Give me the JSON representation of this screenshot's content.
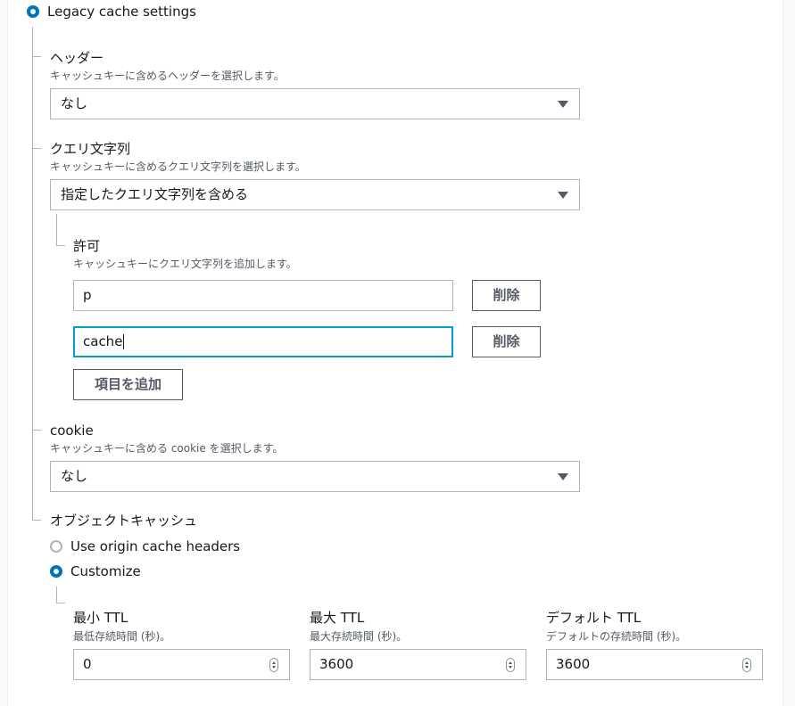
{
  "legacy": {
    "label": "Legacy cache settings"
  },
  "headers": {
    "title": "ヘッダー",
    "description": "キャッシュキーに含めるヘッダーを選択します。",
    "value": "なし"
  },
  "query": {
    "title": "クエリ文字列",
    "description": "キャッシュキーに含めるクエリ文字列を選択します。",
    "value": "指定したクエリ文字列を含める",
    "allow": {
      "title": "許可",
      "description": "キャッシュキーにクエリ文字列を追加します。",
      "items": [
        {
          "value": "p",
          "remove_label": "削除"
        },
        {
          "value": "cache",
          "remove_label": "削除"
        }
      ],
      "add_label": "項目を追加"
    }
  },
  "cookie": {
    "title": "cookie",
    "description": "キャッシュキーに含める cookie を選択します。",
    "value": "なし"
  },
  "object_cache": {
    "title": "オブジェクトキャッシュ",
    "options": [
      {
        "label": "Use origin cache headers",
        "selected": false
      },
      {
        "label": "Customize",
        "selected": true
      }
    ],
    "ttl": {
      "min": {
        "title": "最小 TTL",
        "description": "最低存続時間 (秒)。",
        "value": "0"
      },
      "max": {
        "title": "最大 TTL",
        "description": "最大存続時間 (秒)。",
        "value": "3600"
      },
      "default": {
        "title": "デフォルト TTL",
        "description": "デフォルトの存続時間 (秒)。",
        "value": "3600"
      }
    }
  },
  "colors": {
    "accent": "#0073bb",
    "focus": "#00a1c9",
    "border": "#aab7b8"
  }
}
